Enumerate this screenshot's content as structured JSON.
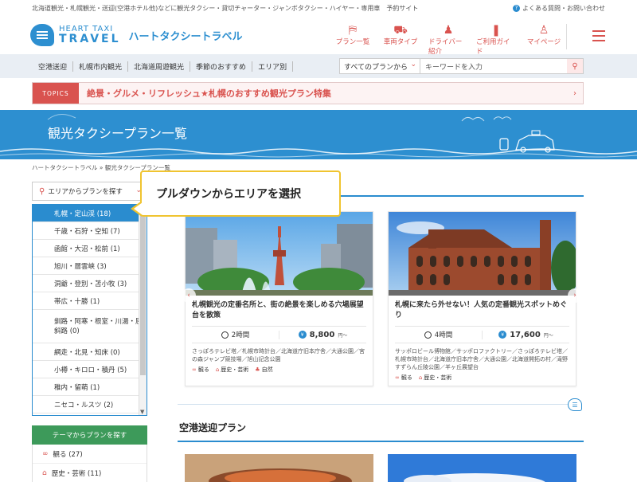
{
  "topbar": {
    "tagline": "北海道観光・札幌観光・送迎(空港ホテル他)などに観光タクシー・貸切チャーター・ジャンボタクシー・ハイヤー・専用車　予約サイト",
    "faq": "よくある質問・お問い合わせ"
  },
  "logo": {
    "en_line1": "HEART TAXI",
    "en_line2": "TRAVEL",
    "jp": "ハートタクシートラベル"
  },
  "nav": [
    {
      "label": "プラン一覧",
      "icon": "bus-stop-icon"
    },
    {
      "label": "車両タイプ",
      "icon": "car-icon"
    },
    {
      "label": "ドライバー紹介",
      "icon": "driver-icon"
    },
    {
      "label": "ご利用ガイド",
      "icon": "guide-book-icon"
    },
    {
      "label": "マイページ",
      "icon": "user-icon"
    }
  ],
  "subnav": [
    "空港送迎",
    "札幌市内観光",
    "北海道周遊観光",
    "季節のおすすめ",
    "エリア別"
  ],
  "search": {
    "select_value": "すべてのプランから",
    "placeholder": "キーワードを入力"
  },
  "topics": {
    "badge": "TOPICS",
    "text": "絶景・グルメ・リフレッシュ★札幌のおすすめ観光プラン特集"
  },
  "hero": {
    "title": "観光タクシープラン一覧"
  },
  "breadcrumb": {
    "home": "ハートタクシートラベル",
    "sep": "»",
    "current": "観光タクシープラン一覧"
  },
  "area_select": {
    "label": "エリアからプランを探す"
  },
  "area_options": [
    "札幌・定山渓 (18)",
    "千歳・石狩・空知 (7)",
    "函館・大沼・松前 (1)",
    "旭川・層雲峡 (3)",
    "洞爺・登別・苫小牧 (3)",
    "帯広・十勝 (1)",
    "釧路・阿寒・根室・川湯・屈斜路 (0)",
    "網走・北見・知床 (0)",
    "小樽・キロロ・積丹 (5)",
    "稚内・留萌 (1)",
    "ニセコ・ルスツ (2)"
  ],
  "callout": "プルダウンからエリアを選択",
  "cards": [
    {
      "title": "札幌観光の定番名所と、街の絶景を楽しめる穴場展望台を散策",
      "duration": "2時間",
      "price": "8,800",
      "price_suffix": "円～",
      "spots": "さっぽろテレビ塔／札幌市時計台／北海道庁旧本庁舎／大通公園／宮の森ジャンプ競技場／旭山記念公園",
      "tags": [
        "観る",
        "歴史・芸術",
        "自然"
      ]
    },
    {
      "title": "札幌に来たら外せない！人気の定番観光スポットめぐり",
      "duration": "4時間",
      "price": "17,600",
      "price_suffix": "円～",
      "spots": "サッポロビール博物館／サッポロファクトリー／さっぽろテレビ塔／札幌市時計台／北海道庁旧本庁舎／大通公園／北海道開拓の村／滝野すずらん丘陵公園／羊ヶ丘展望台",
      "tags": [
        "観る",
        "歴史・芸術"
      ]
    }
  ],
  "airport_section": {
    "title": "空港送迎プラン"
  },
  "theme": {
    "header": "テーマからプランを探す",
    "items": [
      {
        "label": "観る (27)"
      },
      {
        "label": "歴史・芸術 (11)"
      }
    ]
  },
  "colors": {
    "brand_blue": "#2d8fd0",
    "accent_red": "#d9534f",
    "highlight_yellow": "#f0c430",
    "theme_green": "#3d9a5a"
  }
}
